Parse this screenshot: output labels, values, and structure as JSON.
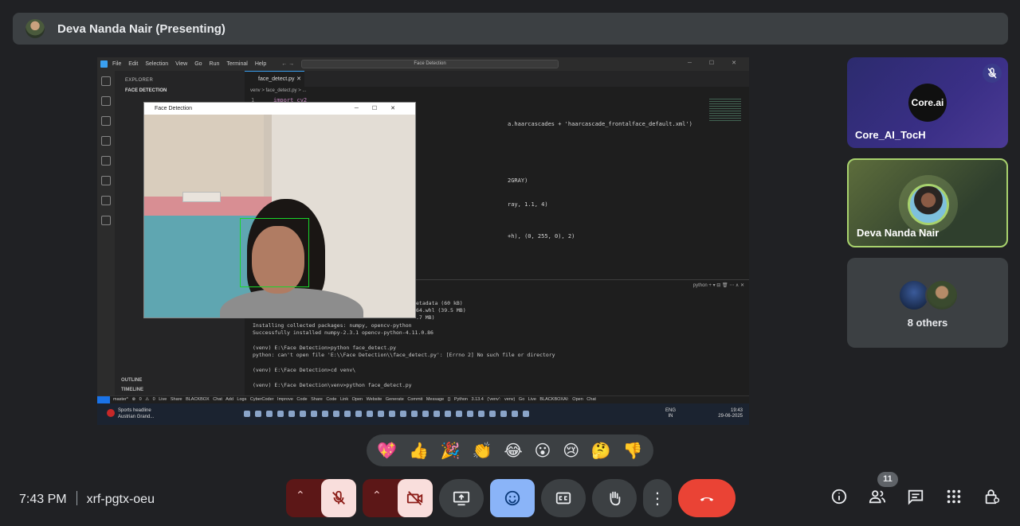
{
  "header": {
    "presenter_title": "Deva Nanda Nair (Presenting)"
  },
  "shared_screen": {
    "vscode": {
      "menu": [
        "File",
        "Edit",
        "Selection",
        "View",
        "Go",
        "Run",
        "Terminal",
        "Help"
      ],
      "search": "Face Detection",
      "explorer_title": "EXPLORER",
      "project": "FACE DETECTION",
      "outline": "OUTLINE",
      "timeline": "TIMELINE",
      "tab": "face_detect.py",
      "breadcrumb": "venv > face_detect.py > ...",
      "code_lines": [
        {
          "n": "1",
          "text": "import cv2"
        },
        {
          "n": "",
          "text": "a.haarcascades + 'haarcascade_frontalface_default.xml')"
        },
        {
          "n": "",
          "text": "2GRAY)"
        },
        {
          "n": "",
          "text": "ray, 1.1, 4)"
        },
        {
          "n": "",
          "text": "+h), (0, 255, 0), 2)"
        }
      ],
      "terminal_label": "python",
      "terminal_lines": [
        "etadata (60 kB)",
        "64.whl (39.5 MB)",
        ".7 MB)",
        "Installing collected packages: numpy, opencv-python",
        "Successfully installed numpy-2.3.1 opencv-python-4.11.0.86",
        "",
        "(venv) E:\\Face Detection>python face_detect.py",
        "python: can't open file 'E:\\\\Face Detection\\\\face_detect.py': [Errno 2] No such file or directory",
        "",
        "(venv) E:\\Face Detection>cd venv\\",
        "",
        "(venv) E:\\Face Detection\\venv>python face_detect.py"
      ],
      "status_items": "master* ⊗ 0 ⚠ 0 Live Share BLACKBOX Chat Add Logs CyberCoder Improve Code Share Code Link Open Website Generate Commit Message {} Python 3.13.4 ('venv': venv) Go Live BLACKBOXAI: Open Chat"
    },
    "taskbar": {
      "news_title": "Sports headline",
      "news_sub": "Austrian Grand...",
      "lang_top": "ENG",
      "lang_bottom": "IN",
      "time": "19:43",
      "date": "29-06-2025"
    },
    "camera_window": {
      "title": "Face Detection"
    }
  },
  "participants": [
    {
      "name": "Core_AI_TocH",
      "logo_text": "Core.ai",
      "muted": true
    },
    {
      "name": "Deva Nanda Nair",
      "speaking": true
    }
  ],
  "others_label": "8 others",
  "reactions": [
    "💖",
    "👍",
    "🎉",
    "👏",
    "😂",
    "😮",
    "😢",
    "🤔",
    "👎"
  ],
  "footer": {
    "time": "7:43 PM",
    "meeting_code": "xrf-pgtx-oeu",
    "people_count": "11"
  },
  "icons": {
    "mic_off": "mic-off-icon",
    "cam_off": "camera-off-icon",
    "present": "present-icon",
    "emoji": "emoji-icon",
    "captions": "captions-icon",
    "hand": "raise-hand-icon",
    "more": "more-icon",
    "leave": "leave-call-icon"
  },
  "colors": {
    "leave": "#ea4335",
    "emoji_active": "#8ab4f8",
    "mic_off_bg": "#f9dedc",
    "speaker_ring": "#a8d26d"
  }
}
